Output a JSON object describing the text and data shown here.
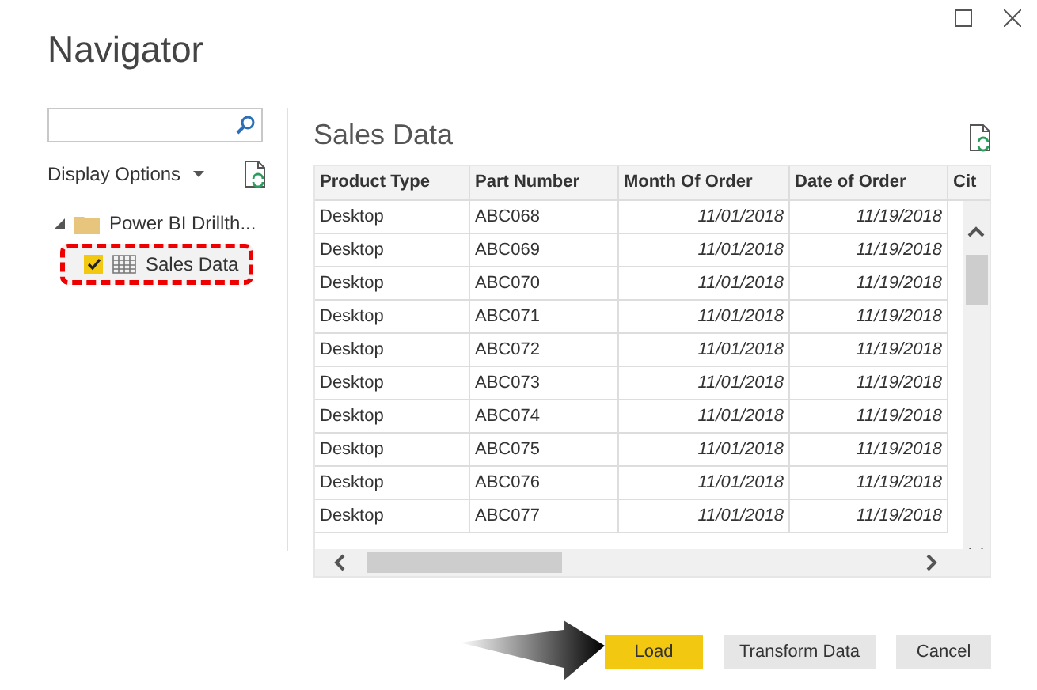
{
  "window": {
    "title": "Navigator"
  },
  "display_options": "Display Options",
  "tree": [
    {
      "label": "Power BI Drillth...",
      "expanded": true,
      "children": [
        {
          "label": "Sales Data",
          "checked": true,
          "selected": true
        }
      ]
    }
  ],
  "preview": {
    "title": "Sales Data",
    "columns": [
      "Product Type",
      "Part Number",
      "Month Of Order",
      "Date of Order",
      "Cit"
    ],
    "rows": [
      [
        "Desktop",
        "ABC068",
        "11/01/2018",
        "11/19/2018"
      ],
      [
        "Desktop",
        "ABC069",
        "11/01/2018",
        "11/19/2018"
      ],
      [
        "Desktop",
        "ABC070",
        "11/01/2018",
        "11/19/2018"
      ],
      [
        "Desktop",
        "ABC071",
        "11/01/2018",
        "11/19/2018"
      ],
      [
        "Desktop",
        "ABC072",
        "11/01/2018",
        "11/19/2018"
      ],
      [
        "Desktop",
        "ABC073",
        "11/01/2018",
        "11/19/2018"
      ],
      [
        "Desktop",
        "ABC074",
        "11/01/2018",
        "11/19/2018"
      ],
      [
        "Desktop",
        "ABC075",
        "11/01/2018",
        "11/19/2018"
      ],
      [
        "Desktop",
        "ABC076",
        "11/01/2018",
        "11/19/2018"
      ],
      [
        "Desktop",
        "ABC077",
        "11/01/2018",
        "11/19/2018"
      ]
    ]
  },
  "buttons": [
    {
      "label": "Load",
      "kind": "primary"
    },
    {
      "label": "Transform Data",
      "kind": "secondary"
    },
    {
      "label": "Cancel",
      "kind": "secondary"
    }
  ]
}
